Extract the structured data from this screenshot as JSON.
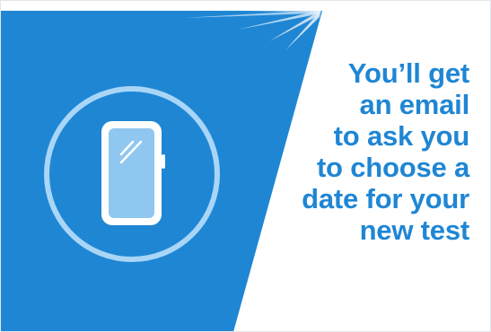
{
  "message": {
    "lines": [
      "You’ll get",
      "an email",
      "to ask you",
      "to choose a",
      "date for your",
      "new test"
    ]
  },
  "colors": {
    "primary_blue": "#1f86d4",
    "light_blue": "#9fd0f5",
    "white": "#ffffff"
  },
  "icons": {
    "phone": "mobile-phone-icon",
    "light_rays": "light-rays-icon"
  }
}
